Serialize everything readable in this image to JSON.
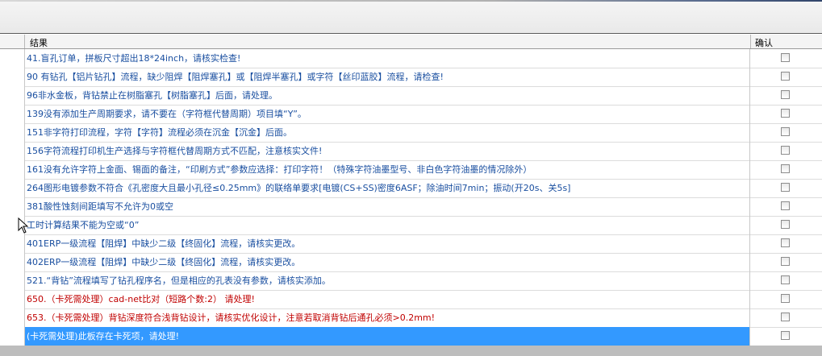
{
  "columns": {
    "result": "结果",
    "confirm": "确认"
  },
  "rows": [
    {
      "text": "41.盲孔订单，拼板尺寸超出18*24inch，请核实检查!",
      "color": "blue"
    },
    {
      "text": "90 有钻孔【铝片钻孔】流程，缺少阻焊【阻焊塞孔】或【阻焊半塞孔】或字符【丝印蓝胶】流程，请检查!",
      "color": "blue"
    },
    {
      "text": "96非水金板，背钻禁止在树脂塞孔【树脂塞孔】后面，请处理。",
      "color": "blue"
    },
    {
      "text": "139没有添加生产周期要求，请不要在（字符框代替周期）项目填“Y”。",
      "color": "blue"
    },
    {
      "text": "151非字符打印流程，字符【字符】流程必须在沉金【沉金】后面。",
      "color": "blue"
    },
    {
      "text": "156字符流程打印机生产选择与字符框代替周期方式不匹配，注意核实文件!",
      "color": "blue"
    },
    {
      "text": "161没有允许字符上金面、锡面的备注，“印刷方式”参数应选择：打印字符！（特殊字符油墨型号、非白色字符油墨的情况除外）",
      "color": "blue"
    },
    {
      "text": "264图形电镀参数不符合《孔密度大且最小孔径≤0.25mm》的联络单要求[电镀(CS+SS)密度6ASF；除油时间7min；振动(开20s、关5s]",
      "color": "blue"
    },
    {
      "text": "381酸性蚀刻间距填写不允许为0或空",
      "color": "blue"
    },
    {
      "text": "工时计算结果不能为空或“0”",
      "color": "blue"
    },
    {
      "text": "401ERP一级流程【阻焊】中缺少二级【终固化】流程，请核实更改。",
      "color": "blue"
    },
    {
      "text": "402ERP一级流程【阻焊】中缺少二级【终固化】流程，请核实更改。",
      "color": "blue"
    },
    {
      "text": "521.“背钻”流程填写了钻孔程序名，但是相应的孔表没有参数，请核实添加。",
      "color": "blue"
    },
    {
      "text": "650.（卡死需处理）cad-net比对（短路个数:2） 请处理!",
      "color": "red"
    },
    {
      "text": "653.（卡死需处理）背钻深度符合浅背钻设计，请核实优化设计，注意若取消背钻后通孔必须>0.2mm!",
      "color": "red"
    },
    {
      "text": "(卡死需处理)此板存在卡死项，请处理!",
      "color": "white",
      "selected": true
    }
  ],
  "colors": {
    "text_blue": "#1a4fa0",
    "text_red": "#c00000",
    "selection": "#3399ff"
  },
  "icons": {
    "checkbox": "checkbox-unchecked",
    "cursor": "mouse-pointer-icon"
  }
}
